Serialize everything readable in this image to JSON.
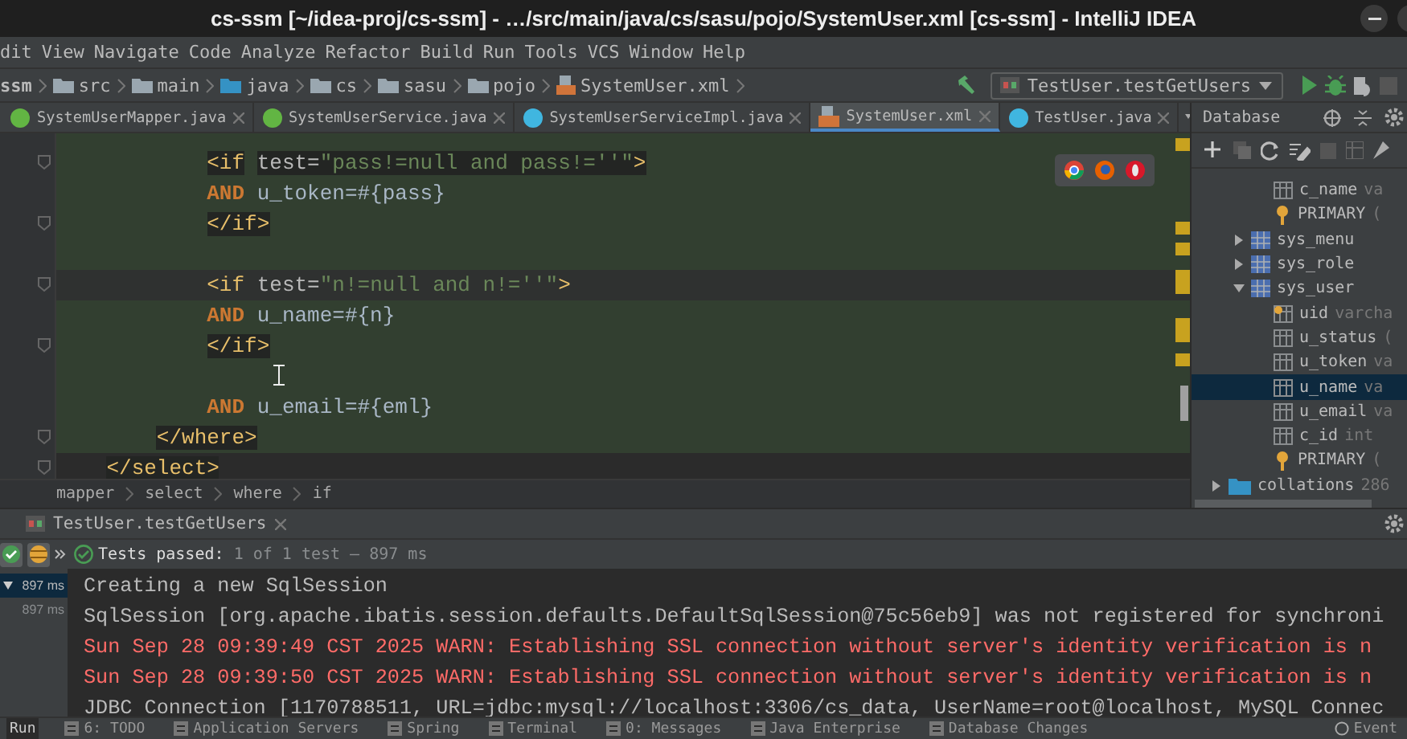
{
  "window": {
    "title": "cs-ssm [~/idea-proj/cs-ssm] - …/src/main/java/cs/sasu/pojo/SystemUser.xml [cs-ssm] - IntelliJ IDEA"
  },
  "menu": [
    "dit",
    "View",
    "Navigate",
    "Code",
    "Analyze",
    "Refactor",
    "Build",
    "Run",
    "Tools",
    "VCS",
    "Window",
    "Help"
  ],
  "breadcrumb": [
    {
      "label": "ssm",
      "kind": "module"
    },
    {
      "label": "src",
      "kind": "folder"
    },
    {
      "label": "main",
      "kind": "folder"
    },
    {
      "label": "java",
      "kind": "source"
    },
    {
      "label": "cs",
      "kind": "package"
    },
    {
      "label": "sasu",
      "kind": "package"
    },
    {
      "label": "pojo",
      "kind": "package"
    },
    {
      "label": "SystemUser.xml",
      "kind": "xml"
    }
  ],
  "run_config": {
    "label": "TestUser.testGetUsers"
  },
  "tabs": [
    {
      "label": "SystemUserMapper.java",
      "kind": "interface",
      "selected": false
    },
    {
      "label": "SystemUserService.java",
      "kind": "interface",
      "selected": false
    },
    {
      "label": "SystemUserServiceImpl.java",
      "kind": "class",
      "selected": false
    },
    {
      "label": "SystemUser.xml",
      "kind": "xml",
      "selected": true
    },
    {
      "label": "TestUser.java",
      "kind": "test",
      "selected": false
    }
  ],
  "editor": {
    "lines": [
      {
        "current": false,
        "injected": true,
        "segments": [
          {
            "kind": "tag",
            "text": "            <if"
          },
          {
            "kind": "attr",
            "text": " test="
          },
          {
            "kind": "string",
            "text": "\"pass!=null and pass!=''\""
          },
          {
            "kind": "tag",
            "text": ">"
          }
        ]
      },
      {
        "current": false,
        "injected": true,
        "segments": [
          {
            "kind": "kw",
            "text": "            AND"
          },
          {
            "kind": "text",
            "text": " u_token=#{pass}"
          }
        ]
      },
      {
        "current": false,
        "injected": true,
        "segments": [
          {
            "kind": "tag",
            "text": "            </if>"
          }
        ]
      },
      {
        "current": false,
        "injected": true
      },
      {
        "current": true,
        "injected": true,
        "segments": [
          {
            "kind": "tag",
            "text": "            <if"
          },
          {
            "kind": "attr",
            "text": " test="
          },
          {
            "kind": "string",
            "text": "\"n!=null and n!=''\""
          },
          {
            "kind": "tag",
            "text": ">"
          }
        ]
      },
      {
        "current": false,
        "injected": true,
        "segments": [
          {
            "kind": "kw",
            "text": "            AND"
          },
          {
            "kind": "text",
            "text": " u_name=#{n}"
          }
        ]
      },
      {
        "current": false,
        "injected": true,
        "segments": [
          {
            "kind": "tag",
            "text": "            </if>"
          }
        ]
      },
      {
        "current": false,
        "injected": true
      },
      {
        "current": false,
        "injected": true,
        "segments": [
          {
            "kind": "kw",
            "text": "            AND"
          },
          {
            "kind": "text",
            "text": " u_email=#{eml}"
          }
        ]
      },
      {
        "current": false,
        "injected": true,
        "segments": [
          {
            "kind": "tag",
            "text": "        </where>"
          }
        ]
      },
      {
        "current": false,
        "injected": false,
        "segments": [
          {
            "kind": "tag",
            "text": "    </select>"
          }
        ]
      }
    ],
    "structure": [
      "mapper",
      "select",
      "where",
      "if"
    ]
  },
  "database": {
    "title": "Database",
    "tree": [
      {
        "children": [
          {
            "children": [
              {
                "label": "c_name",
                "detail": "va",
                "kind": "column",
                "selected": false
              },
              {
                "label": "PRIMARY",
                "detail": "(",
                "kind": "key",
                "selected": false
              }
            ]
          },
          {
            "label": "sys_menu",
            "kind": "table",
            "expanded": false,
            "selected": false
          },
          {
            "label": "sys_role",
            "kind": "table",
            "expanded": false,
            "selected": false
          },
          {
            "label": "sys_user",
            "kind": "table",
            "expanded": true,
            "selected": false,
            "children": [
              {
                "label": "uid",
                "detail": "varcha",
                "kind": "pk",
                "selected": false
              },
              {
                "label": "u_status",
                "detail": "(",
                "kind": "column",
                "selected": false
              },
              {
                "label": "u_token",
                "detail": "va",
                "kind": "column",
                "selected": false
              },
              {
                "label": "u_name",
                "detail": "va",
                "kind": "column",
                "selected": true
              },
              {
                "label": "u_email",
                "detail": "va",
                "kind": "column",
                "selected": false
              },
              {
                "label": "c_id",
                "detail": "int",
                "kind": "column",
                "selected": false
              },
              {
                "label": "PRIMARY",
                "detail": "(",
                "kind": "key",
                "selected": false
              }
            ]
          }
        ]
      },
      {
        "label": "collations",
        "detail": "286",
        "kind": "folder",
        "expanded": false,
        "selected": false
      }
    ]
  },
  "run": {
    "tab": "TestUser.testGetUsers",
    "status": "Tests passed:",
    "summary": "1 of 1 test – 897 ms",
    "tests": [
      {
        "time": "897 ms",
        "selected": true
      },
      {
        "time": "897 ms",
        "selected": false
      }
    ],
    "console": [
      {
        "kind": "info",
        "text": "Creating a new SqlSession"
      },
      {
        "kind": "info",
        "text": "SqlSession [org.apache.ibatis.session.defaults.DefaultSqlSession@75c56eb9] was not registered for synchroni"
      },
      {
        "kind": "warn",
        "text": "Sun Sep 28 09:39:49 CST 2025 WARN: Establishing SSL connection without server's identity verification is n"
      },
      {
        "kind": "warn",
        "text": "Sun Sep 28 09:39:50 CST 2025 WARN: Establishing SSL connection without server's identity verification is n"
      },
      {
        "kind": "info",
        "text": "JDBC Connection [1170788511, URL=jdbc:mysql://localhost:3306/cs_data, UserName=root@localhost, MySQL Connec"
      }
    ]
  },
  "tool_windows": [
    {
      "label": "Run",
      "selected": true
    },
    {
      "label": "6: TODO",
      "selected": false
    },
    {
      "label": "Application Servers",
      "selected": false
    },
    {
      "label": "Spring",
      "selected": false
    },
    {
      "label": "Terminal",
      "selected": false
    },
    {
      "label": "0: Messages",
      "selected": false
    },
    {
      "label": "Java Enterprise",
      "selected": false
    },
    {
      "label": "Database Changes",
      "selected": false
    }
  ],
  "event_log": "Event"
}
